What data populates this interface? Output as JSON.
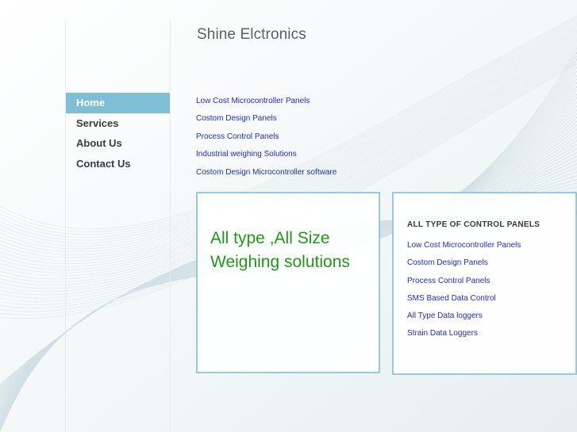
{
  "site_title": "Shine Elctronics",
  "nav": [
    {
      "label": "Home",
      "active": true
    },
    {
      "label": "Services",
      "active": false
    },
    {
      "label": "About Us",
      "active": false
    },
    {
      "label": "Contact Us",
      "active": false
    }
  ],
  "top_links": [
    "Low Cost Microcontroller  Panels",
    "Costom Design Panels",
    "Process Control Panels",
    "Industrial weighing Solutions",
    "Costom Design Microcontroller  software"
  ],
  "feature_box": {
    "headline": "All type ,All Size Weighing solutions"
  },
  "panels_box": {
    "heading": "ALL TYPE OF CONTROL PANELS",
    "links": [
      "Low Cost Microcontroller  Panels",
      "Costom Design Panels",
      "Process Control Panels",
      "SMS Based Data Control",
      "All Type Data loggers",
      "Strain Data Loggers"
    ]
  },
  "colors": {
    "nav_active_bg": "#7fbfd6",
    "link": "#1f2ec8",
    "headline": "#1f9a12",
    "box_border": "#93cbe0"
  }
}
